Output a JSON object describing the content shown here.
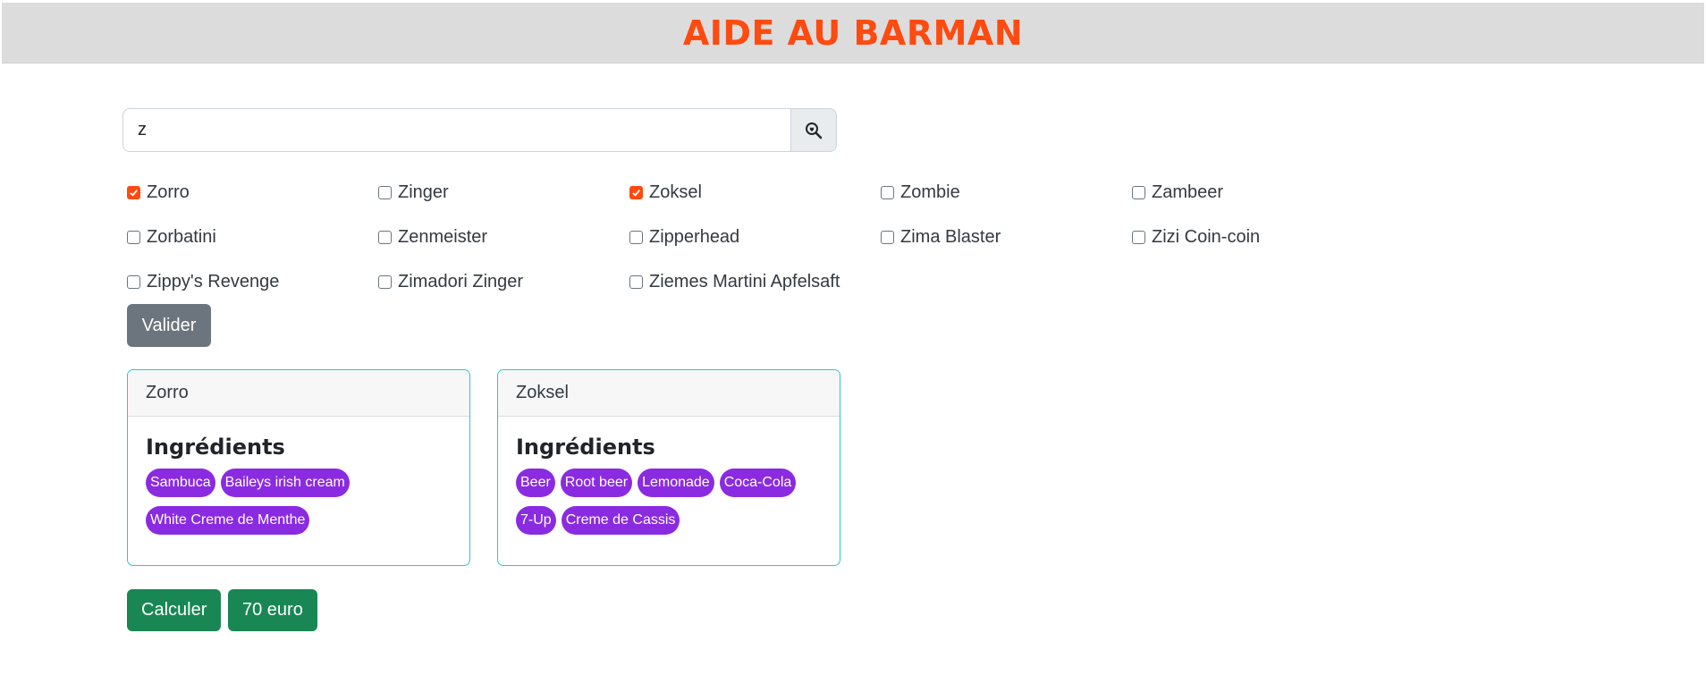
{
  "header": {
    "title": "AIDE AU BARMAN"
  },
  "search": {
    "value": "z"
  },
  "cocktails": [
    {
      "label": "Zorro",
      "checked": true
    },
    {
      "label": "Zinger",
      "checked": false
    },
    {
      "label": "Zoksel",
      "checked": true
    },
    {
      "label": "Zombie",
      "checked": false
    },
    {
      "label": "Zambeer",
      "checked": false
    },
    {
      "label": "Zorbatini",
      "checked": false
    },
    {
      "label": "Zenmeister",
      "checked": false
    },
    {
      "label": "Zipperhead",
      "checked": false
    },
    {
      "label": "Zima Blaster",
      "checked": false
    },
    {
      "label": "Zizi Coin-coin",
      "checked": false
    },
    {
      "label": "Zippy's Revenge",
      "checked": false
    },
    {
      "label": "Zimadori Zinger",
      "checked": false
    },
    {
      "label": "Ziemes Martini Apfelsaft",
      "checked": false
    }
  ],
  "valider_label": "Valider",
  "cards": [
    {
      "name": "Zorro",
      "title": "Ingrédients",
      "ingredients": [
        "Sambuca",
        "Baileys irish cream",
        "White Creme de Menthe"
      ]
    },
    {
      "name": "Zoksel",
      "title": "Ingrédients",
      "ingredients": [
        "Beer",
        "Root beer",
        "Lemonade",
        "Coca-Cola",
        "7-Up",
        "Creme de Cassis"
      ]
    }
  ],
  "actions": {
    "calculer_label": "Calculer",
    "price_label": "70 euro"
  },
  "colors": {
    "accent": "#ff4a10",
    "badge": "#8a2be2",
    "card_border": "#2cc4dc",
    "success": "#198754",
    "secondary": "#6c757d"
  }
}
